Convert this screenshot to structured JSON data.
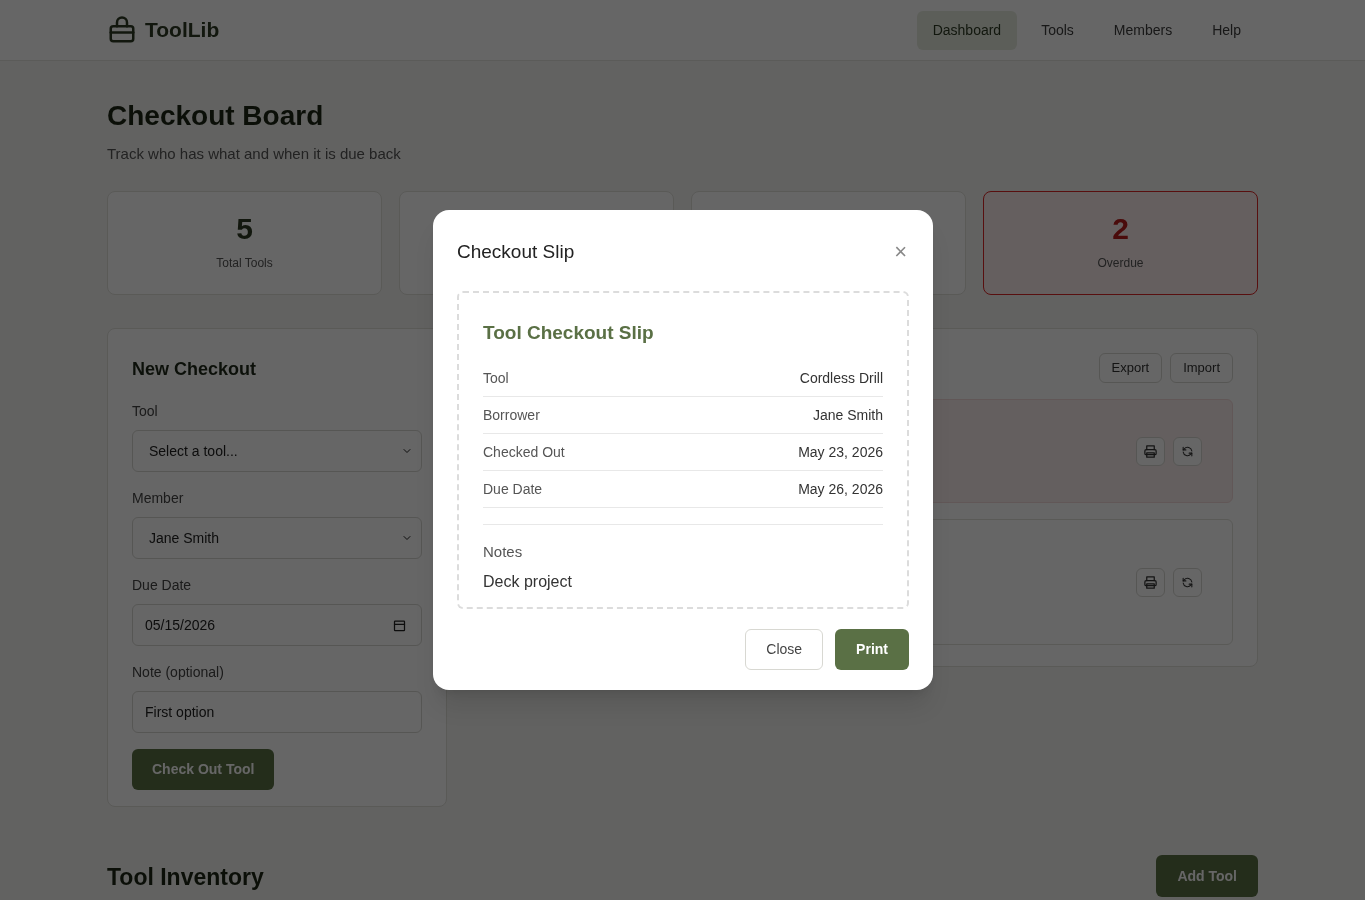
{
  "header": {
    "brand": "ToolLib",
    "nav": [
      {
        "label": "Dashboard",
        "selected": true
      },
      {
        "label": "Tools",
        "selected": false
      },
      {
        "label": "Members",
        "selected": false
      },
      {
        "label": "Help",
        "selected": false
      }
    ]
  },
  "page": {
    "title": "Checkout Board",
    "subtitle": "Track who has what and when it is due back"
  },
  "stats": [
    {
      "value": "5",
      "label": "Total Tools",
      "alert": false
    },
    {
      "alert": false
    },
    {
      "alert": false
    },
    {
      "value": "2",
      "label": "Overdue",
      "alert": true
    }
  ],
  "new_checkout": {
    "title": "New Checkout",
    "fields": [
      {
        "label": "Tool",
        "kind": "select",
        "value": "Select a tool..."
      },
      {
        "label": "Member",
        "kind": "select",
        "value": "Jane Smith"
      },
      {
        "label": "Due Date",
        "kind": "date",
        "value": "05/15/2026"
      },
      {
        "label": "Note (optional)",
        "kind": "text",
        "value": "First option"
      }
    ],
    "submit": "Check Out Tool"
  },
  "checkouts": {
    "buttons": [
      "Export",
      "Import"
    ],
    "items": [
      {
        "overdue": true
      },
      {
        "overdue": false
      }
    ]
  },
  "inventory": {
    "title": "Tool Inventory",
    "button": "Add Tool"
  },
  "modal": {
    "title": "Checkout Slip",
    "close_icon": "×",
    "slip": {
      "heading": "Tool Checkout Slip",
      "rows": [
        {
          "label": "Tool",
          "value": "Cordless Drill"
        },
        {
          "label": "Borrower",
          "value": "Jane Smith"
        },
        {
          "label": "Checked Out",
          "value": "May 23, 2026"
        },
        {
          "label": "Due Date",
          "value": "May 26, 2026"
        }
      ],
      "notes_label": "Notes",
      "notes": "Deck project"
    },
    "buttons": [
      {
        "label": "Close",
        "kind": "secondary"
      },
      {
        "label": "Print",
        "kind": "primary"
      }
    ]
  }
}
